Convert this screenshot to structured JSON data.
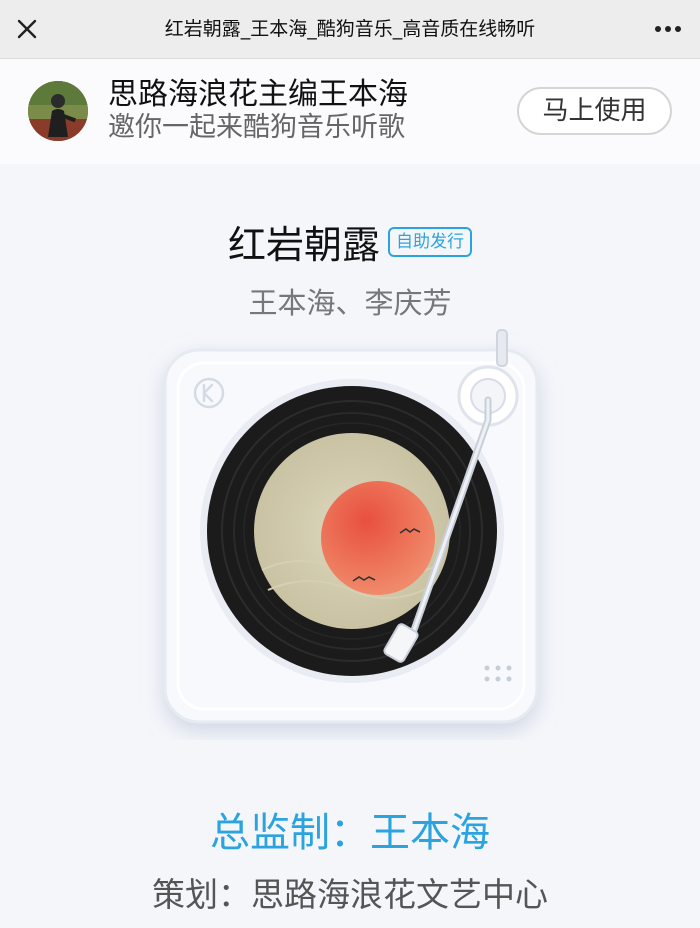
{
  "window": {
    "title": "红岩朝露_王本海_酷狗音乐_高音质在线畅听",
    "close_icon": "close-icon",
    "more_icon": "more-dots-icon"
  },
  "banner": {
    "name": "思路海浪花主编王本海",
    "subtitle": "邀你一起来酷狗音乐听歌",
    "button_label": "马上使用"
  },
  "song": {
    "title": "红岩朝露",
    "badge": "自助发行",
    "artists": "王本海、李庆芳"
  },
  "player": {
    "logo_icon": "kugou-k-icon",
    "record_icon": "vinyl-record-icon",
    "tonearm_icon": "tonearm-icon",
    "speaker_icon": "speaker-dots-icon"
  },
  "credits": {
    "main": "总监制：王本海",
    "sub": "策划：思路海浪花文艺中心"
  },
  "colors": {
    "accent": "#2ba3df",
    "badge": "#2aa4e0",
    "background": "#f4f6fa",
    "sun": "#e8503e"
  }
}
